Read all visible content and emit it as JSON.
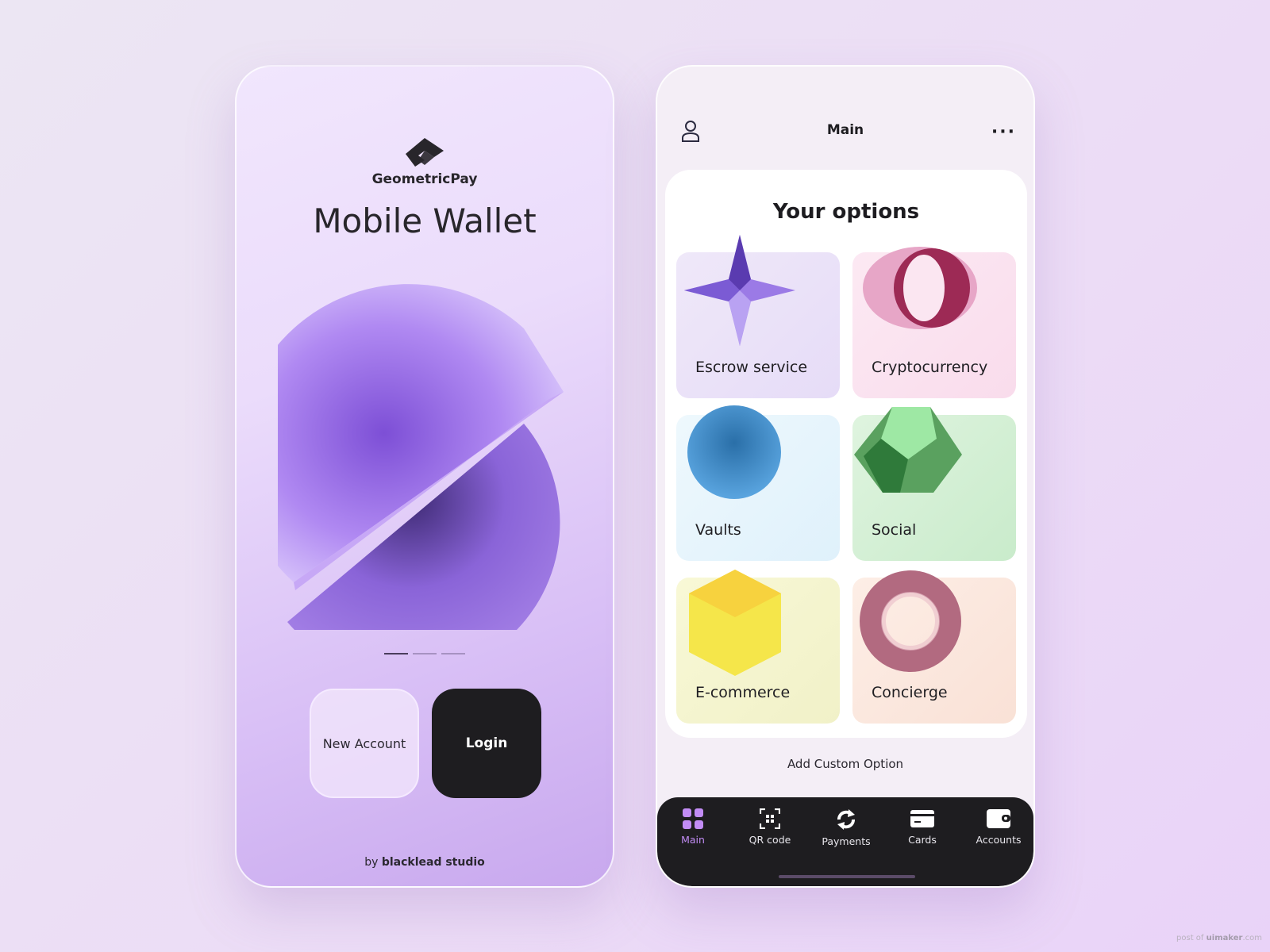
{
  "welcome": {
    "brand": "GeometricPay",
    "title": "Mobile Wallet",
    "carousel": {
      "pages": 3,
      "current": 1
    },
    "new_account_label": "New Account",
    "login_label": "Login",
    "by_prefix": "by",
    "by_name": "blacklead studio"
  },
  "main": {
    "header_title": "Main",
    "more_label": "···",
    "section_title": "Your options",
    "options": [
      {
        "label": "Escrow service",
        "color": "#ece4f8",
        "icon": "star-octahedron-icon"
      },
      {
        "label": "Cryptocurrency",
        "color": "#fbe3ef",
        "icon": "ring-icon"
      },
      {
        "label": "Vaults",
        "color": "#e3f3fb",
        "icon": "cone-disc-icon"
      },
      {
        "label": "Social",
        "color": "#d5f0d6",
        "icon": "dodecahedron-icon"
      },
      {
        "label": "E-commerce",
        "color": "#f5f5cf",
        "icon": "cube-icon"
      },
      {
        "label": "Concierge",
        "color": "#fbe6dc",
        "icon": "torus-icon"
      }
    ],
    "add_custom": "Add Custom Option",
    "tabs": [
      {
        "label": "Main",
        "icon": "grid-icon",
        "active": true
      },
      {
        "label": "QR code",
        "icon": "qr-icon"
      },
      {
        "label": "Payments",
        "icon": "refresh-icon"
      },
      {
        "label": "Cards",
        "icon": "card-icon"
      },
      {
        "label": "Accounts",
        "icon": "wallet-icon"
      }
    ],
    "accent": "#c28cf5"
  },
  "watermark": {
    "prefix": "post of",
    "site": "uimaker",
    ".suffix": ".com",
    "suffix": ".com"
  }
}
